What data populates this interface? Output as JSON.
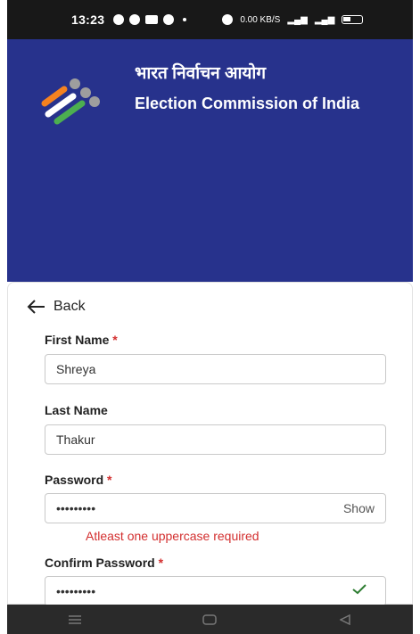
{
  "status": {
    "time": "13:23",
    "network_speed": "0.00 KB/S"
  },
  "header": {
    "title_hindi": "भारत निर्वाचन आयोग",
    "title_english": "Election Commission of India",
    "logo_colors": [
      "#f58220",
      "#ffffff",
      "#4caf50",
      "#9e9e9e"
    ]
  },
  "form": {
    "back_label": "Back",
    "first_name": {
      "label": "First Name",
      "required_mark": "*",
      "value": "Shreya"
    },
    "last_name": {
      "label": "Last Name",
      "value": "Thakur"
    },
    "password": {
      "label": "Password",
      "required_mark": "*",
      "value": "•••••••••",
      "toggle_label": "Show",
      "error": "Atleast one uppercase required"
    },
    "confirm_password": {
      "label": "Confirm Password",
      "required_mark": "*",
      "value": "•••••••••"
    }
  },
  "colors": {
    "header_bg": "#27328c",
    "error": "#d32f2f",
    "success": "#2e7d32"
  }
}
